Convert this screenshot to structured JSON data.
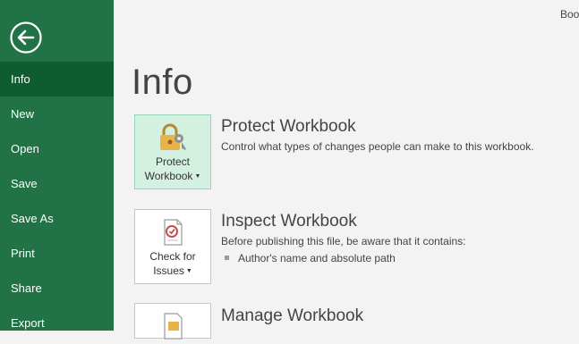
{
  "sidebar": {
    "back_label": "Back",
    "items": [
      {
        "label": "Info",
        "active": true
      },
      {
        "label": "New",
        "active": false
      },
      {
        "label": "Open",
        "active": false
      },
      {
        "label": "Save",
        "active": false
      },
      {
        "label": "Save As",
        "active": false
      },
      {
        "label": "Print",
        "active": false
      },
      {
        "label": "Share",
        "active": false
      },
      {
        "label": "Export",
        "active": false
      }
    ]
  },
  "header": {
    "doc_title": "Boo"
  },
  "main": {
    "title": "Info",
    "protect": {
      "tile_line1": "Protect",
      "tile_line2": "Workbook",
      "heading": "Protect Workbook",
      "description": "Control what types of changes people can make to this workbook."
    },
    "inspect": {
      "tile_line1": "Check for",
      "tile_line2": "Issues",
      "heading": "Inspect Workbook",
      "description": "Before publishing this file, be aware that it contains:",
      "bullets": [
        "Author's name and absolute path"
      ]
    },
    "manage": {
      "heading": "Manage Workbook"
    }
  },
  "colors": {
    "sidebar_bg": "#217346",
    "sidebar_active": "#0e5c30",
    "selected_tile": "#d3f0e0"
  }
}
